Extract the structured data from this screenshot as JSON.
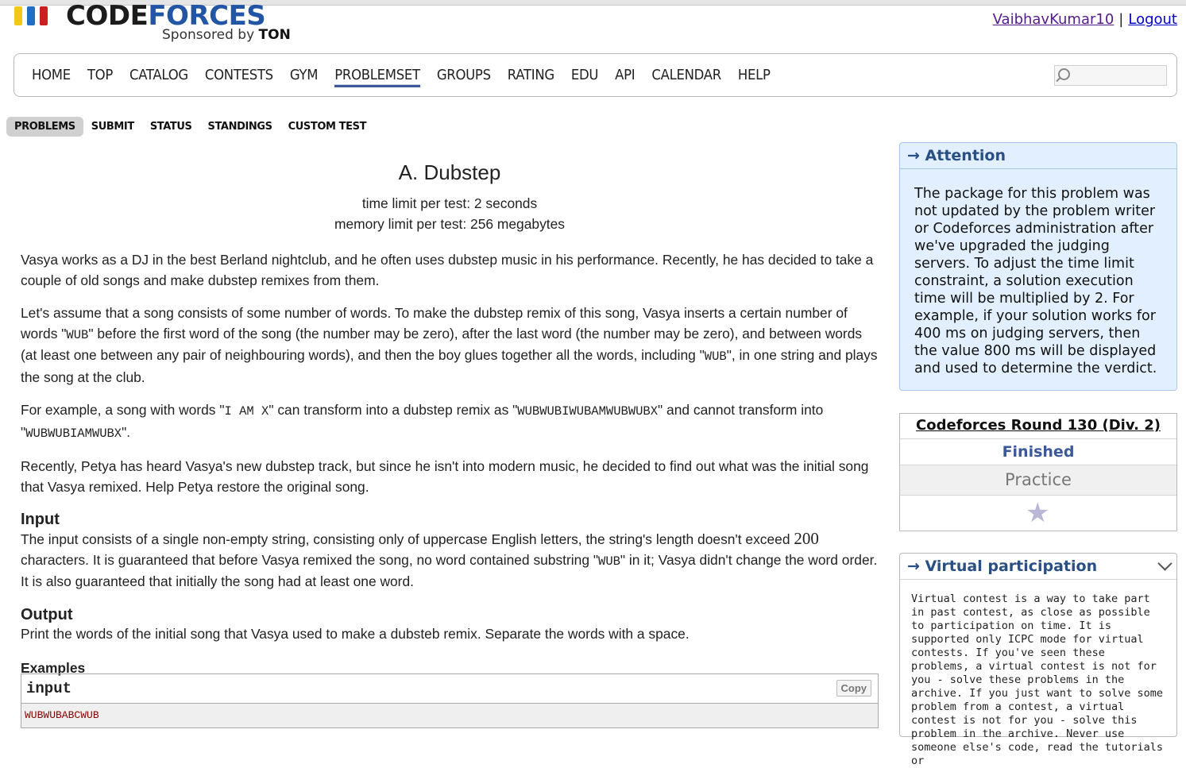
{
  "logo": {
    "word_part1": "CODE",
    "word_part2": "FORCES",
    "sponsored": "Sponsored by",
    "sponsor_name": "TON"
  },
  "user": {
    "name": "VaibhavKumar10",
    "separator": "|",
    "logout": "Logout"
  },
  "menu": [
    "HOME",
    "TOP",
    "CATALOG",
    "CONTESTS",
    "GYM",
    "PROBLEMSET",
    "GROUPS",
    "RATING",
    "EDU",
    "API",
    "CALENDAR",
    "HELP"
  ],
  "menu_active": "PROBLEMSET",
  "submenu": [
    "PROBLEMS",
    "SUBMIT",
    "STATUS",
    "STANDINGS",
    "CUSTOM TEST"
  ],
  "submenu_active": "PROBLEMS",
  "problem": {
    "title": "A. Dubstep",
    "time_limit": "time limit per test: 2 seconds",
    "memory_limit": "memory limit per test: 256 megabytes",
    "p1": "Vasya works as a DJ in the best Berland nightclub, and he often uses dubstep music in his performance. Recently, he has decided to take a couple of old songs and make dubstep remixes from them.",
    "p2_a": "Let's assume that a song consists of some number of words. To make the dubstep remix of this song, Vasya inserts a certain number of words \"",
    "p2_m1": "WUB",
    "p2_b": "\" before the first word of the song (the number may be zero), after the last word (the number may be zero), and between words (at least one between any pair of neighbouring words), and then the boy glues together all the words, including \"",
    "p2_m2": "WUB",
    "p2_c": "\", in one string and plays the song at the club.",
    "p3_a": "For example, a song with words \"",
    "p3_m1": "I AM X",
    "p3_b": "\" can transform into a dubstep remix as \"",
    "p3_m2": "WUBWUBIWUBAMWUBWUBX",
    "p3_c": "\" and cannot transform into \"",
    "p3_m3": "WUBWUBIAMWUBX",
    "p3_d": "\".",
    "p4": "Recently, Petya has heard Vasya's new dubstep track, but since he isn't into modern music, he decided to find out what was the initial song that Vasya remixed. Help Petya restore the original song.",
    "input_title": "Input",
    "input_a": "The input consists of a single non-empty string, consisting only of uppercase English letters, the string's length doesn't exceed ",
    "input_num": "200",
    "input_b": " characters. It is guaranteed that before Vasya remixed the song, no word contained substring \"",
    "input_m": "WUB",
    "input_c": "\" in it; Vasya didn't change the word order. It is also guaranteed that initially the song had at least one word.",
    "output_title": "Output",
    "output_text": "Print the words of the initial song that Vasya used to make a dubsteb remix. Separate the words with a space.",
    "examples_title": "Examples",
    "sample_input_label": "input",
    "copy_label": "Copy",
    "sample_input_value": "WUBWUBABCWUB"
  },
  "attention": {
    "title": "→ Attention",
    "text": "The package for this problem was not updated by the problem writer or Codeforces administration after we've upgraded the judging servers. To adjust the time limit constraint, a solution execution time will be multiplied by 2. For example, if your solution works for 400 ms on judging servers, then the value 800 ms will be displayed and used to determine the verdict."
  },
  "round": {
    "name": "Codeforces Round 130 (Div. 2)",
    "status": "Finished",
    "mode": "Practice",
    "star_icon": "star-icon"
  },
  "virtual": {
    "title": "→ Virtual participation",
    "text": "Virtual contest is a way to take part in past contest, as close as possible to participation on time. It is supported only ICPC mode for virtual contests. If you've seen these problems, a virtual contest is not for you - solve these problems in the archive. If you just want to solve some problem from a contest, a virtual contest is not for you - solve this problem in the archive. Never use someone else's code, read the tutorials or"
  },
  "colors": {
    "accent": "#3b5998",
    "attention_bg": "#e1efff",
    "sample_text": "#8b0000"
  }
}
